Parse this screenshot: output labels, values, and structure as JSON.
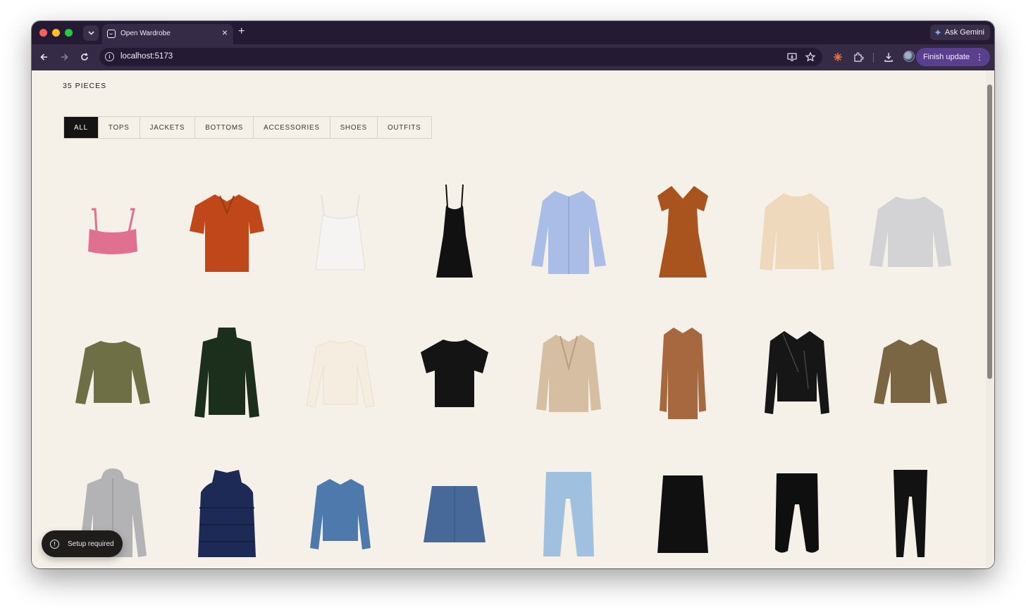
{
  "browser": {
    "tab_title": "Open Wardrobe",
    "close_glyph": "×",
    "new_tab_glyph": "+",
    "ask_gemini_label": "Ask Gemini",
    "url": "localhost:5173",
    "finish_update_label": "Finish update"
  },
  "page": {
    "count_label": "35 PIECES",
    "filters": [
      "ALL",
      "TOPS",
      "JACKETS",
      "BOTTOMS",
      "ACCESSORIES",
      "SHOES",
      "OUTFITS"
    ],
    "active_filter": "ALL",
    "toast_label": "Setup required"
  },
  "items": [
    {
      "name": "pink-sports-bra",
      "color": "#e0708f"
    },
    {
      "name": "rust-polo-shirt",
      "color": "#c0471a"
    },
    {
      "name": "white-ribbed-tank",
      "color": "#f6f4f2"
    },
    {
      "name": "black-slip-dress",
      "color": "#111111"
    },
    {
      "name": "light-blue-button-shirt",
      "color": "#a9bde6"
    },
    {
      "name": "rust-wrap-dress",
      "color": "#a9531f"
    },
    {
      "name": "cream-knit-sweater",
      "color": "#efd9bd"
    },
    {
      "name": "grey-sweatshirt",
      "color": "#d3d3d5"
    },
    {
      "name": "olive-henley",
      "color": "#6f6f46"
    },
    {
      "name": "dark-green-turtleneck",
      "color": "#1c2e1c"
    },
    {
      "name": "cream-long-sleeve",
      "color": "#f5eee0"
    },
    {
      "name": "black-tshirt",
      "color": "#141414"
    },
    {
      "name": "beige-blazer",
      "color": "#d5bea2"
    },
    {
      "name": "camel-coat",
      "color": "#a8683f"
    },
    {
      "name": "black-leather-jacket",
      "color": "#161616"
    },
    {
      "name": "olive-work-jacket",
      "color": "#7a6642"
    },
    {
      "name": "grey-zip-hoodie",
      "color": "#b3b3b5"
    },
    {
      "name": "navy-puffer-vest",
      "color": "#1d2a55"
    },
    {
      "name": "denim-jacket",
      "color": "#4e79ad"
    },
    {
      "name": "denim-skirt",
      "color": "#46699a"
    },
    {
      "name": "light-wash-jeans",
      "color": "#9fc1df"
    },
    {
      "name": "black-pleated-skirt",
      "color": "#101010"
    },
    {
      "name": "black-joggers",
      "color": "#0f0f0f"
    },
    {
      "name": "black-leggings",
      "color": "#121212"
    }
  ]
}
